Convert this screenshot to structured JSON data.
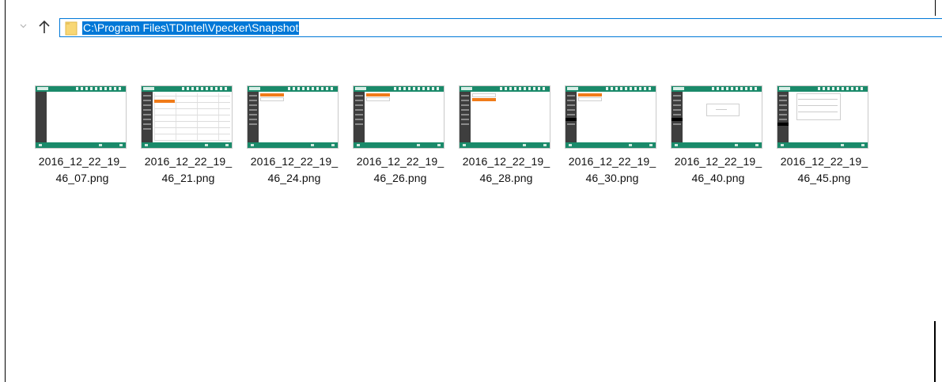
{
  "address_bar": {
    "path": "C:\\Program Files\\TDIntel\\Vpecker\\Snapshot"
  },
  "icons": {
    "recent": "chevron-down-icon",
    "up": "up-arrow-icon",
    "folder": "folder-icon"
  },
  "colors": {
    "accent": "#0078d7",
    "thumbnail_header": "#1a8a6a",
    "thumbnail_highlight": "#f07b19",
    "folder": "#f8d775"
  },
  "files": [
    {
      "name_line1": "2016_12_22_19_",
      "name_line2": "46_07.png"
    },
    {
      "name_line1": "2016_12_22_19_",
      "name_line2": "46_21.png"
    },
    {
      "name_line1": "2016_12_22_19_",
      "name_line2": "46_24.png"
    },
    {
      "name_line1": "2016_12_22_19_",
      "name_line2": "46_26.png"
    },
    {
      "name_line1": "2016_12_22_19_",
      "name_line2": "46_28.png"
    },
    {
      "name_line1": "2016_12_22_19_",
      "name_line2": "46_30.png"
    },
    {
      "name_line1": "2016_12_22_19_",
      "name_line2": "46_40.png"
    },
    {
      "name_line1": "2016_12_22_19_",
      "name_line2": "46_45.png"
    }
  ]
}
